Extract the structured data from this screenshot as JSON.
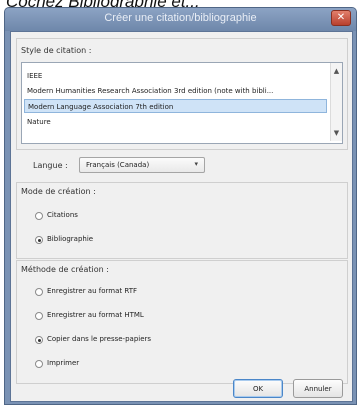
{
  "background_text": "Cochez Bibliographie et...",
  "window": {
    "title": "Créer une citation/bibliographie",
    "close_symbol": "✕"
  },
  "style": {
    "label": "Style de citation :",
    "items": [
      "IEEE",
      "Modern Humanities Research Association 3rd edition (note with bibli...",
      "Modern Language Association 7th edition",
      "Nature"
    ],
    "selected_index": 2,
    "scroll_up": "▲",
    "scroll_down": "▼"
  },
  "langue": {
    "label": "Langue :",
    "value": "Français (Canada)",
    "arrow": "▾"
  },
  "mode": {
    "label": "Mode de création :",
    "options": [
      "Citations",
      "Bibliographie"
    ],
    "selected_index": 1
  },
  "methode": {
    "label": "Méthode de création :",
    "options": [
      "Enregistrer au format RTF",
      "Enregistrer au format HTML",
      "Copier dans le presse-papiers",
      "Imprimer"
    ],
    "selected_index": 2
  },
  "buttons": {
    "ok": "OK",
    "cancel": "Annuler"
  },
  "colors": {
    "titlebar": "#7a92b4",
    "selection": "#cfe3f7"
  }
}
